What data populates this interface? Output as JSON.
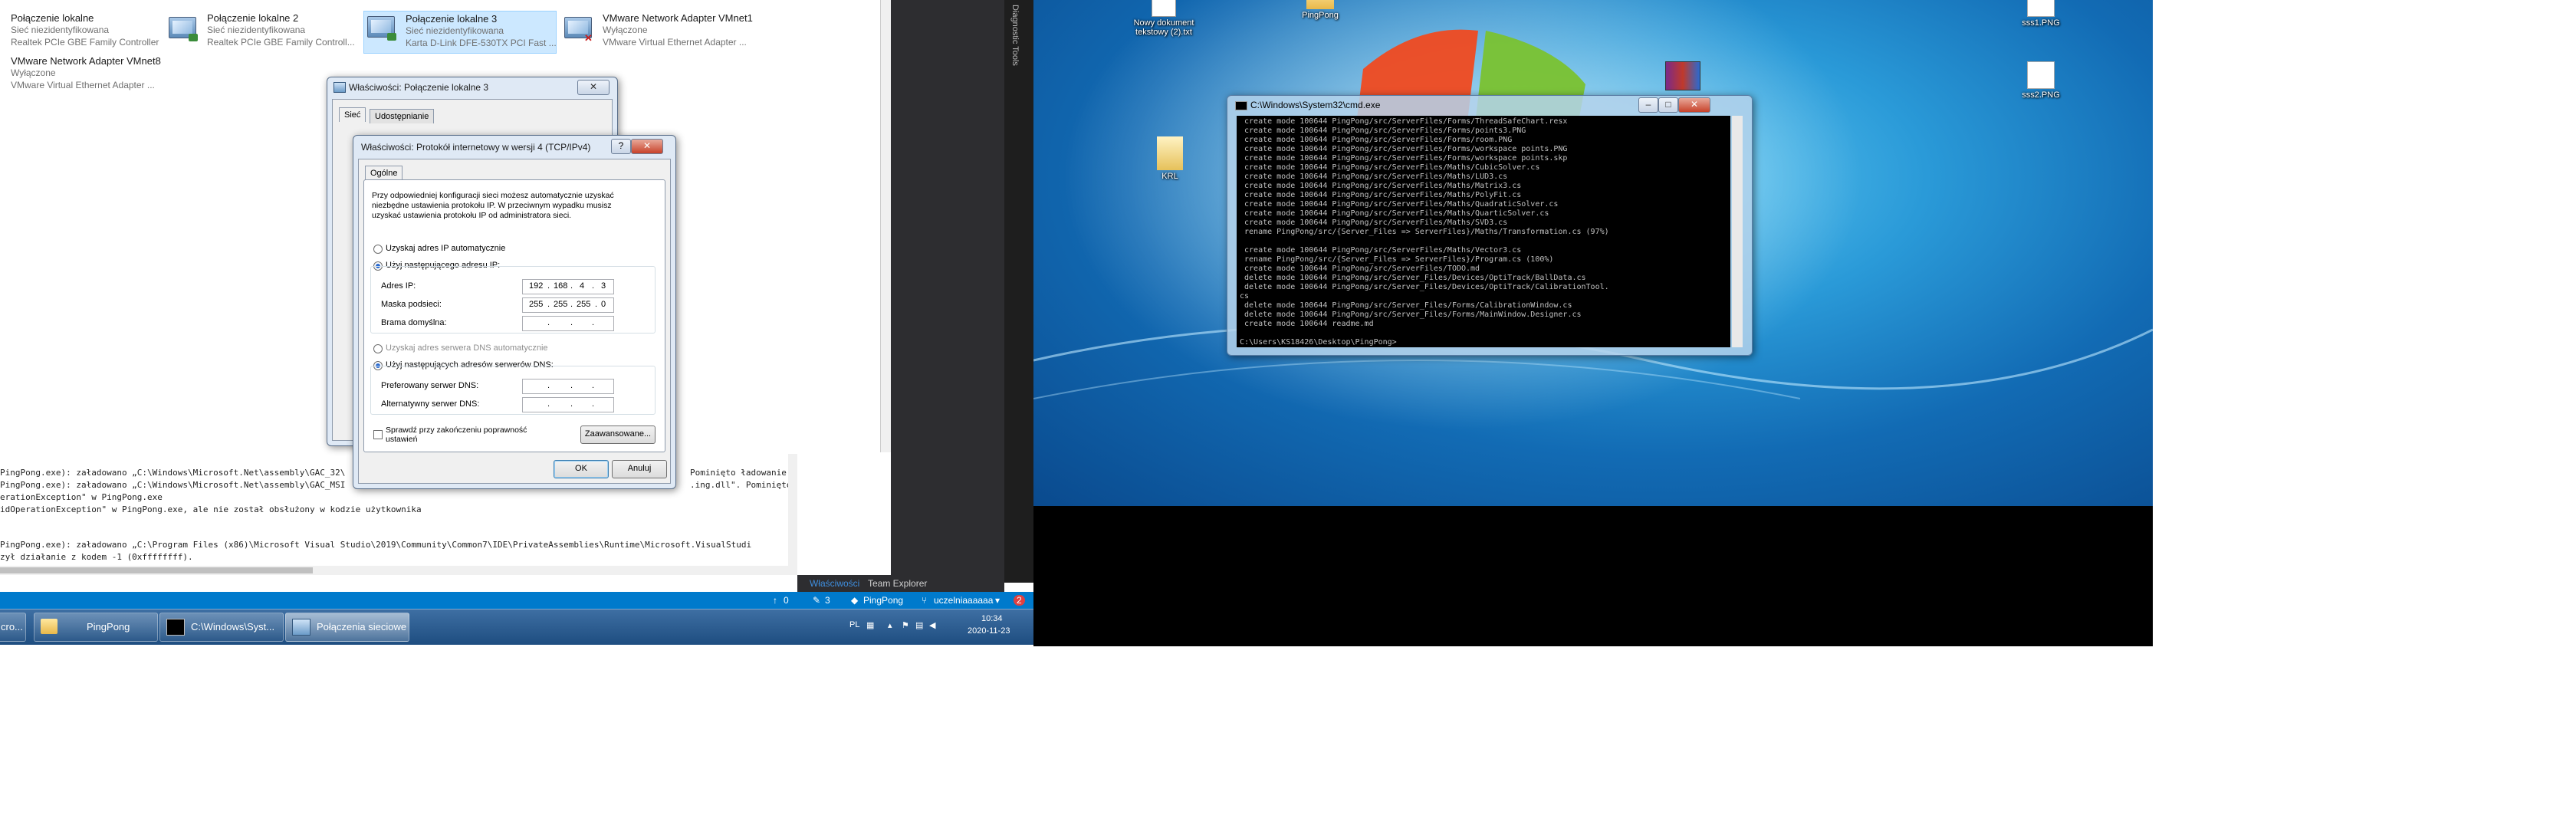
{
  "adapters": [
    {
      "name": "Połączenie lokalne",
      "status": "Sieć niezidentyfikowana",
      "device": "Realtek PCIe GBE Family Controller"
    },
    {
      "name": "Połączenie lokalne 2",
      "status": "Sieć niezidentyfikowana",
      "device": "Realtek PCIe GBE Family Controll..."
    },
    {
      "name": "Połączenie lokalne 3",
      "status": "Sieć niezidentyfikowana",
      "device": "Karta D-Link DFE-530TX PCI Fast ..."
    },
    {
      "name": "VMware Network Adapter VMnet1",
      "status": "Wyłączone",
      "device": "VMware Virtual Ethernet Adapter ..."
    },
    {
      "name": "VMware Network Adapter VMnet8",
      "status": "Wyłączone",
      "device": "VMware Virtual Ethernet Adapter ..."
    }
  ],
  "props_dialog": {
    "title": "Właściwości: Połączenie lokalne 3",
    "tabs": [
      "Sieć",
      "Udostępnianie"
    ]
  },
  "ipv4_dialog": {
    "title": "Właściwości: Protokół internetowy w wersji 4 (TCP/IPv4)",
    "tab": "Ogólne",
    "description": "Przy odpowiedniej konfiguracji sieci możesz automatycznie uzyskać niezbędne ustawienia protokołu IP. W przeciwnym wypadku musisz uzyskać ustawienia protokołu IP od administratora sieci.",
    "auto_ip": "Uzyskaj adres IP automatycznie",
    "manual_ip": "Użyj następującego adresu IP:",
    "ip_label": "Adres IP:",
    "ip": [
      "192",
      "168",
      "4",
      "3"
    ],
    "mask_label": "Maska podsieci:",
    "mask": [
      "255",
      "255",
      "255",
      "0"
    ],
    "gateway_label": "Brama domyślna:",
    "auto_dns": "Uzyskaj adres serwera DNS automatycznie",
    "manual_dns": "Użyj następujących adresów serwerów DNS:",
    "pref_dns": "Preferowany serwer DNS:",
    "alt_dns": "Alternatywny serwer DNS:",
    "validate": "Sprawdź przy zakończeniu poprawność ustawień",
    "advanced": "Zaawansowane...",
    "ok": "OK",
    "cancel": "Anuluj"
  },
  "output_lines": [
    "PingPong.exe): załadowano „C:\\Windows\\Microsoft.Net\\assembly\\GAC_32\\",
    "PingPong.exe): załadowano „C:\\Windows\\Microsoft.Net\\assembly\\GAC_MSI",
    "erationException\" w PingPong.exe",
    "idOperationException\" w PingPong.exe, ale nie został obsłużony w kodzie użytkownika",
    "",
    "PingPong.exe): załadowano „C:\\Program Files (x86)\\Microsoft Visual Studio\\2019\\Community\\Common7\\IDE\\PrivateAssemblies\\Runtime\\Microsoft.VisualStudi",
    "zył działanie z kodem -1 (0xffffffff)."
  ],
  "output_right": [
    "Pominięto ładowanie",
    ".ing.dll\". Pominięto"
  ],
  "vs_strip": "Diagnostic Tools",
  "vs_tabs": [
    "Właściwości",
    "Team Explorer"
  ],
  "status_bar": {
    "up": "0",
    "edits": "3",
    "repo": "PingPong",
    "branch": "uczelniaaaaaa",
    "errors": "2"
  },
  "taskbar": {
    "items": [
      "cro...",
      "PingPong",
      "C:\\Windows\\Syst...",
      "Połączenia sieciowe"
    ],
    "lang": "PL",
    "time": "10:34",
    "date": "2020-11-23"
  },
  "desktop_icons": [
    "Nowy dokument tekstowy (2).txt",
    "PingPong",
    "KRL",
    "sss1.PNG",
    "sss2.PNG"
  ],
  "cmd": {
    "title": "C:\\Windows\\System32\\cmd.exe",
    "lines": [
      " create mode 100644 PingPong/src/ServerFiles/Forms/ThreadSafeChart.resx",
      " create mode 100644 PingPong/src/ServerFiles/Forms/points3.PNG",
      " create mode 100644 PingPong/src/ServerFiles/Forms/room.PNG",
      " create mode 100644 PingPong/src/ServerFiles/Forms/workspace points.PNG",
      " create mode 100644 PingPong/src/ServerFiles/Forms/workspace points.skp",
      " create mode 100644 PingPong/src/ServerFiles/Maths/CubicSolver.cs",
      " create mode 100644 PingPong/src/ServerFiles/Maths/LUD3.cs",
      " create mode 100644 PingPong/src/ServerFiles/Maths/Matrix3.cs",
      " create mode 100644 PingPong/src/ServerFiles/Maths/PolyFit.cs",
      " create mode 100644 PingPong/src/ServerFiles/Maths/QuadraticSolver.cs",
      " create mode 100644 PingPong/src/ServerFiles/Maths/QuarticSolver.cs",
      " create mode 100644 PingPong/src/ServerFiles/Maths/SVD3.cs",
      " rename PingPong/src/{Server_Files => ServerFiles}/Maths/Transformation.cs (97%)",
      "",
      " create mode 100644 PingPong/src/ServerFiles/Maths/Vector3.cs",
      " rename PingPong/src/{Server_Files => ServerFiles}/Program.cs (100%)",
      " create mode 100644 PingPong/src/ServerFiles/TODO.md",
      " delete mode 100644 PingPong/src/Server_Files/Devices/OptiTrack/BallData.cs",
      " delete mode 100644 PingPong/src/Server_Files/Devices/OptiTrack/CalibrationTool.",
      "cs",
      " delete mode 100644 PingPong/src/Server_Files/Forms/CalibrationWindow.cs",
      " delete mode 100644 PingPong/src/Server_Files/Forms/MainWindow.Designer.cs",
      " create mode 100644 readme.md",
      "",
      "C:\\Users\\KS18426\\Desktop\\PingPong>"
    ]
  }
}
